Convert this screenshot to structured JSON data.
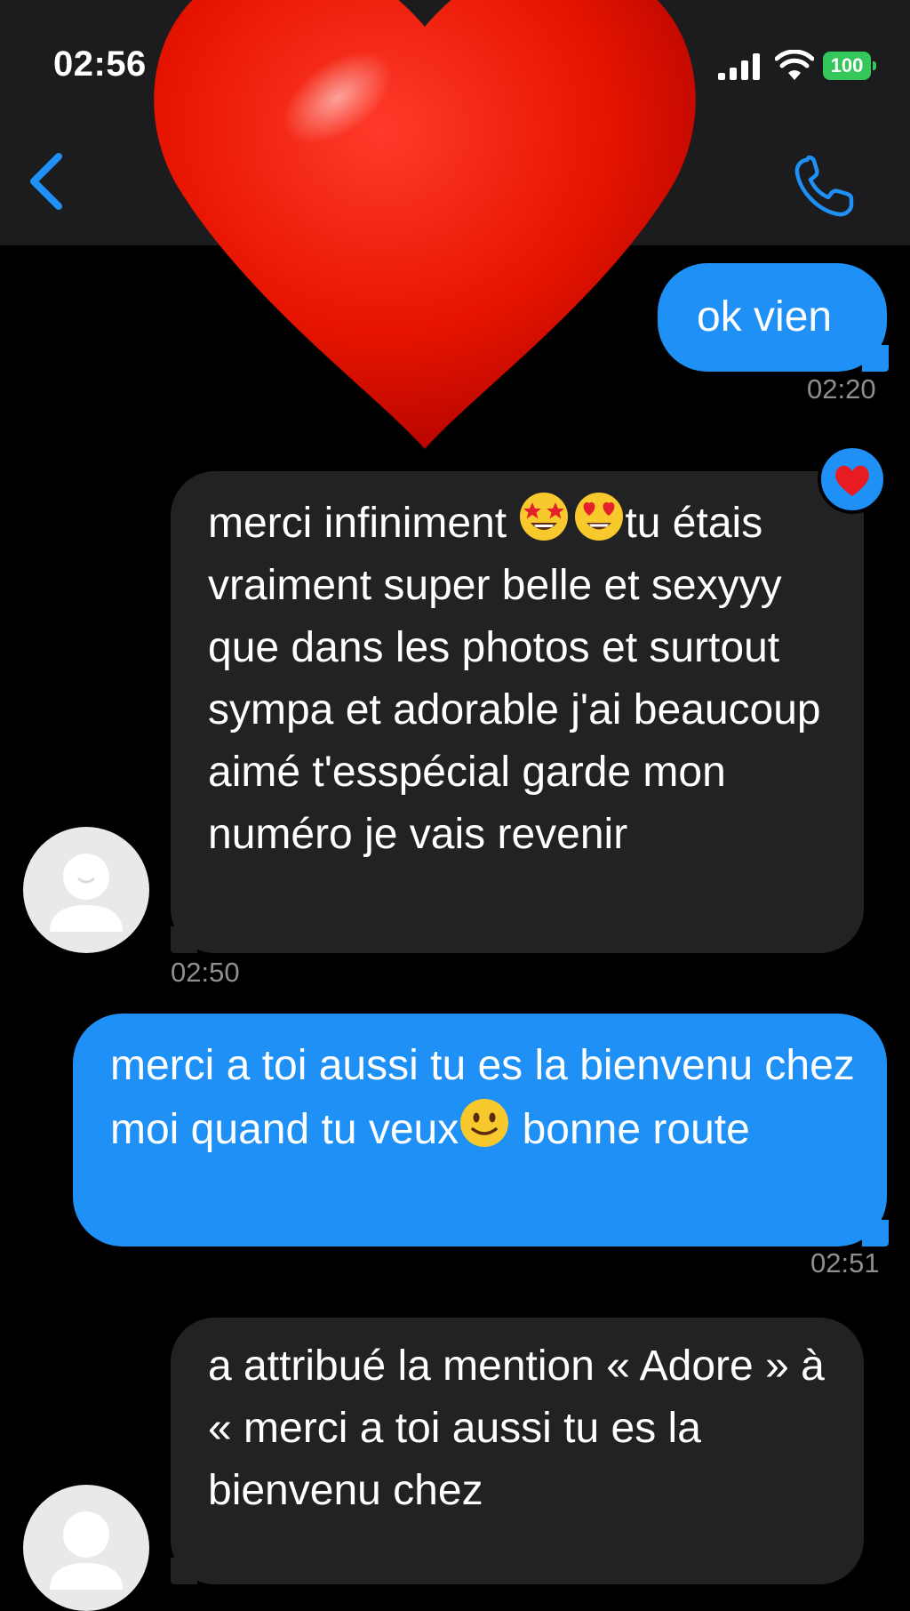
{
  "status_bar": {
    "time": "02:56",
    "battery_level": "100",
    "battery_color": "#34c759"
  },
  "header": {
    "back_icon": "chevron-left-icon",
    "call_icon": "phone-icon",
    "accent_color": "#1e90f6"
  },
  "sticker": {
    "icon": "red-heart-icon",
    "color": "#e10600"
  },
  "messages": [
    {
      "direction": "outgoing",
      "text": "ok vien",
      "time": "02:20"
    },
    {
      "direction": "incoming",
      "text_part1": "merci infiniment ",
      "emoji1": "star-struck-emoji",
      "emoji2": "heart-eyes-emoji",
      "text_part2": "tu étais vraiment super belle et sexyyy que dans les photos et surtout sympa et adorable j'ai beaucoup aimé t'esspécial garde mon numéro je vais revenir",
      "reaction": "red-heart-icon",
      "time": "02:50"
    },
    {
      "direction": "outgoing",
      "text_part1": "merci a toi aussi tu es la bienvenu chez moi quand tu veux",
      "emoji1": "slightly-smiling-emoji",
      "text_part2": " bonne route",
      "time": "02:51"
    },
    {
      "direction": "incoming",
      "text": "a attribué la mention « Adore » à « merci a toi aussi tu es la bienvenu chez"
    }
  ],
  "colors": {
    "outgoing_bubble": "#1e90f6",
    "incoming_bubble": "#222224",
    "timestamp": "#8e8e93",
    "background": "#000000"
  }
}
